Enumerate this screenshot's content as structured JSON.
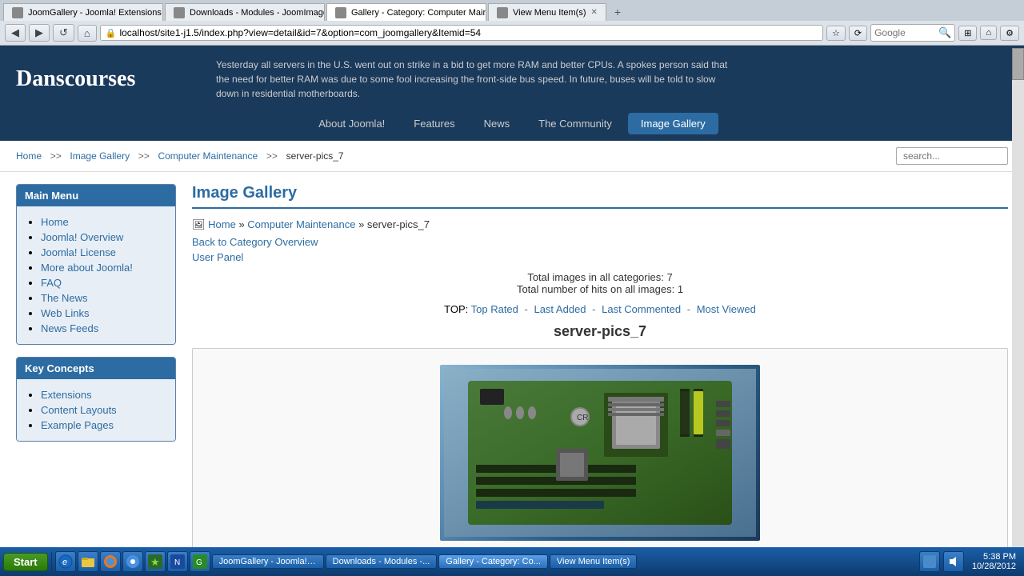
{
  "browser": {
    "tabs": [
      {
        "id": "tab1",
        "label": "JoomGallery - Joomla! Extensions Directory",
        "active": false
      },
      {
        "id": "tab2",
        "label": "Downloads - Modules - JoomImages",
        "active": false
      },
      {
        "id": "tab3",
        "label": "Gallery - Category: Computer Maintenan...",
        "active": true
      },
      {
        "id": "tab4",
        "label": "View Menu Item(s)",
        "active": false
      }
    ],
    "address": "localhost/site1-j1.5/index.php?view=detail&id=7&option=com_joomgallery&Itemid=54",
    "google_placeholder": "Google"
  },
  "site": {
    "name": "Danscourses",
    "tagline": "Yesterday all servers in the U.S. went out on strike in a bid to get more RAM and better CPUs. A spokes person said that the need for better RAM was due to some fool increasing the front-side bus speed. In future, buses will be told to slow down in residential motherboards."
  },
  "nav": {
    "items": [
      {
        "label": "About Joomla!",
        "active": false
      },
      {
        "label": "Features",
        "active": false
      },
      {
        "label": "News",
        "active": false
      },
      {
        "label": "The Community",
        "active": false
      },
      {
        "label": "Image Gallery",
        "active": true
      }
    ]
  },
  "breadcrumb": {
    "items": [
      {
        "label": "Home",
        "href": "#"
      },
      {
        "label": "Image Gallery",
        "href": "#"
      },
      {
        "label": "Computer Maintenance",
        "href": "#"
      },
      {
        "label": "server-pics_7",
        "href": null
      }
    ],
    "search_placeholder": "search..."
  },
  "sidebar": {
    "main_menu": {
      "title": "Main Menu",
      "items": [
        {
          "label": "Home"
        },
        {
          "label": "Joomla! Overview"
        },
        {
          "label": "Joomla! License"
        },
        {
          "label": "More about Joomla!"
        },
        {
          "label": "FAQ"
        },
        {
          "label": "The News"
        },
        {
          "label": "Web Links"
        },
        {
          "label": "News Feeds"
        }
      ]
    },
    "key_concepts": {
      "title": "Key Concepts",
      "items": [
        {
          "label": "Extensions"
        },
        {
          "label": "Content Layouts"
        },
        {
          "label": "Example Pages"
        }
      ]
    }
  },
  "main": {
    "page_title": "Image Gallery",
    "breadcrumb_icon": "🖼",
    "breadcrumb_home": "Home",
    "breadcrumb_category": "Computer Maintenance",
    "breadcrumb_gallery": "server-pics_7",
    "back_link": "Back to Category Overview",
    "user_panel": "User Panel",
    "stats": {
      "total_images": "Total images in all categories: 7",
      "total_hits": "Total number of hits on all images: 1"
    },
    "top_label": "TOP:",
    "top_links": [
      {
        "label": "Top Rated"
      },
      {
        "label": "Last Added"
      },
      {
        "label": "Last Commented"
      },
      {
        "label": "Most Viewed"
      }
    ],
    "gallery_name": "server-pics_7"
  },
  "taskbar": {
    "start_label": "Start",
    "items": [
      {
        "label": "JoomGallery - Joomla! ..."
      },
      {
        "label": "Downloads - Modules -..."
      },
      {
        "label": "Gallery - Category: Co..."
      },
      {
        "label": "View Menu Item(s)"
      }
    ],
    "time": "5:38 PM",
    "date": "10/28/2012"
  }
}
